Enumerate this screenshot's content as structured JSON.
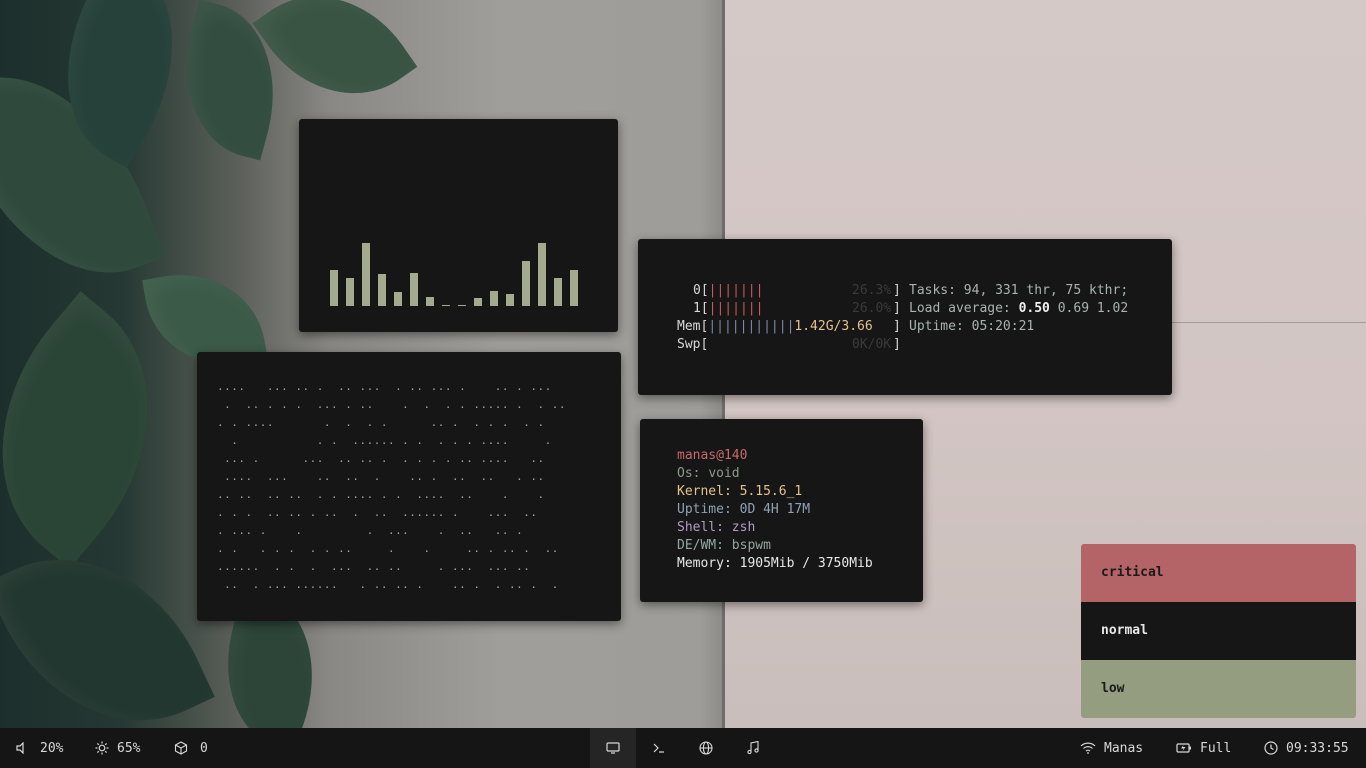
{
  "visualizer": {
    "bar_levels": [
      0.53,
      0.41,
      0.93,
      0.47,
      0.21,
      0.48,
      0.13,
      0.01,
      0.01,
      0.12,
      0.22,
      0.18,
      0.66,
      0.93,
      0.41,
      0.53
    ]
  },
  "dots": {
    "lines": [
      "....   ... .. .  .. ...  . .. ... .    .. . ...",
      " .  .. . . .  ... . ..    .  .  . . ..... .  . ..",
      ". . ....       .  .  . .      .. .  . . .  . .",
      "  .           . .  ...... . .  . . . ....     .",
      " ... .      ...  .. .. .  . . . . .. ....   ..",
      " ....  ...    ..  ..  .    .. .  ..  ..   . ..",
      ".. ..  .. ..  . . .... . .  ....  ..    .    .",
      ". . .  .. .. . ..  .  ..  ...... .    ...  ..",
      ". ... .    .         .  ...    .  ..   .. .",
      ". .   . . .  . . ..     .    .     .. . .. .  ..",
      "......  . .  .  ...  .. ..     . ...  ... ..",
      " ..  . ... ......   . .. .. .    .. .  . .. .  ."
    ]
  },
  "htop": {
    "cpu0_label": "0[",
    "cpu0_bars": "|||||||",
    "cpu0_value": "26.3%",
    "cpu1_label": "1[",
    "cpu1_bars": "|||||||",
    "cpu1_value": "26.0%",
    "mem_label": "Mem[",
    "mem_bars": "|||||||||||",
    "mem_value": "1.42G/3.66",
    "swp_label": "Swp[",
    "swp_value": "0K/0K",
    "close_bracket": "]",
    "tasks_label": "Tasks:",
    "tasks_value": "94, 331 thr, 75 kthr;",
    "load_label": "Load average:",
    "load_1": "0.50",
    "load_5": "0.69",
    "load_15": "1.02",
    "uptime_label": "Uptime:",
    "uptime_value": "05:20:21"
  },
  "fetch": {
    "user": "manas@140",
    "os_label": "Os:",
    "os_value": "void",
    "kernel_label": "Kernel:",
    "kernel_value": "5.15.6_1",
    "uptime_label": "Uptime:",
    "uptime_value": "0D 4H 17M",
    "shell_label": "Shell:",
    "shell_value": "zsh",
    "dewm_label": "DE/WM:",
    "dewm_value": "bspwm",
    "memory_label": "Memory:",
    "memory_value": "1905Mib / 3750Mib"
  },
  "notifications": {
    "critical": "critical",
    "normal": "normal",
    "low": "low"
  },
  "taskbar": {
    "volume": "20%",
    "brightness": "65%",
    "updates": "0",
    "wifi": "Manas",
    "battery": "Full",
    "clock": "09:33:55"
  },
  "colors": {
    "critical": "#b46466",
    "low": "#949d7f",
    "panel": "#161616",
    "bar": "#a3aa8e"
  }
}
